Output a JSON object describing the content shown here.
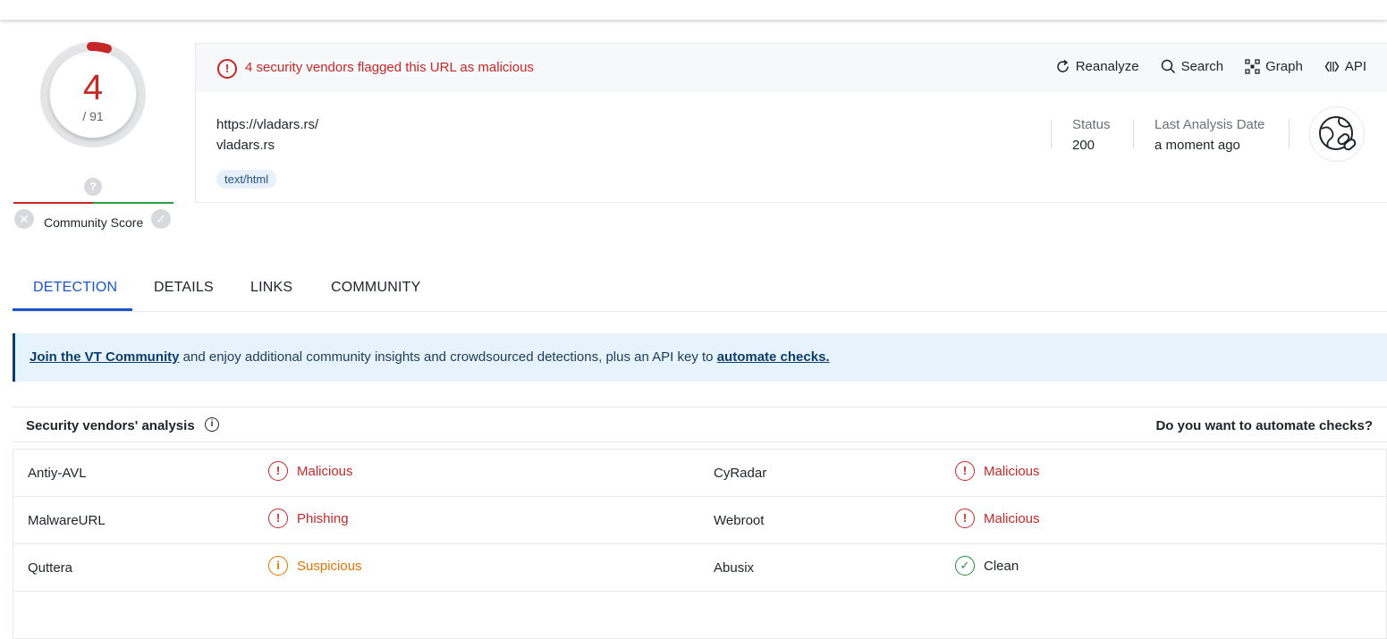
{
  "score": {
    "detections": "4",
    "total": "/ 91",
    "community_label": "Community Score",
    "community_value": "?"
  },
  "alert": {
    "text": "4 security vendors flagged this URL as malicious"
  },
  "actions": [
    {
      "label": "Reanalyze",
      "icon": "refresh-icon"
    },
    {
      "label": "Search",
      "icon": "search-icon"
    },
    {
      "label": "Graph",
      "icon": "graph-icon"
    },
    {
      "label": "API",
      "icon": "api-icon"
    }
  ],
  "target": {
    "url": "https://vladars.rs/",
    "domain": "vladars.rs",
    "tag": "text/html"
  },
  "meta": {
    "status_label": "Status",
    "status_value": "200",
    "date_label": "Last Analysis Date",
    "date_value": "a moment ago"
  },
  "tabs": [
    "DETECTION",
    "DETAILS",
    "LINKS",
    "COMMUNITY"
  ],
  "banner": {
    "link1": "Join the VT Community",
    "middle": " and enjoy additional community insights and crowdsourced detections, plus an API key to ",
    "link2": "automate checks."
  },
  "vendors": {
    "title": "Security vendors' analysis",
    "right_link": "Do you want to automate checks?",
    "rows": [
      [
        {
          "name": "Antiy-AVL",
          "result": "Malicious",
          "kind": "malicious"
        },
        {
          "name": "CyRadar",
          "result": "Malicious",
          "kind": "malicious"
        }
      ],
      [
        {
          "name": "MalwareURL",
          "result": "Phishing",
          "kind": "malicious"
        },
        {
          "name": "Webroot",
          "result": "Malicious",
          "kind": "malicious"
        }
      ],
      [
        {
          "name": "Quttera",
          "result": "Suspicious",
          "kind": "suspicious"
        },
        {
          "name": "Abusix",
          "result": "Clean",
          "kind": "clean"
        }
      ]
    ]
  },
  "colors": {
    "malicious": "#c62828",
    "suspicious": "#e37400",
    "clean": "#1e8e3e",
    "accent": "#1a56c9"
  }
}
